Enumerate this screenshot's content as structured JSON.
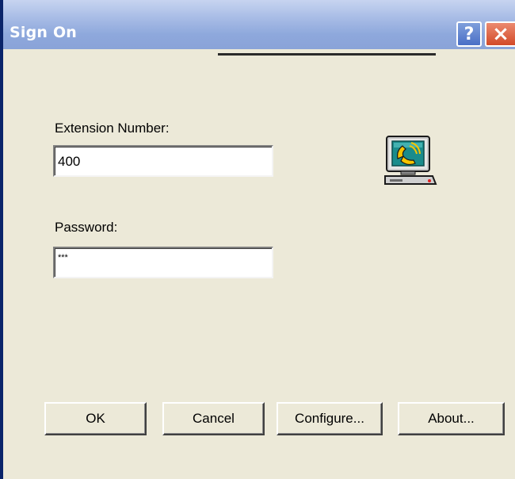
{
  "window": {
    "title": "Sign On",
    "help_glyph": "?",
    "close_glyph": "×"
  },
  "form": {
    "extension": {
      "label": "Extension Number:",
      "value": "400"
    },
    "password": {
      "label": "Password:",
      "value": "***"
    }
  },
  "icon": {
    "name": "computer-phone-icon",
    "colors": {
      "screen": "#1a8c8c",
      "handset": "#f5c400",
      "case": "#c0c0c0"
    }
  },
  "buttons": {
    "ok": "OK",
    "cancel": "Cancel",
    "configure": "Configure...",
    "about": "About..."
  },
  "colors": {
    "titlebar": "#8ea8dc",
    "dialog_bg": "#ece9d8",
    "close_button": "#d34a28",
    "help_button": "#4a6fc6"
  }
}
